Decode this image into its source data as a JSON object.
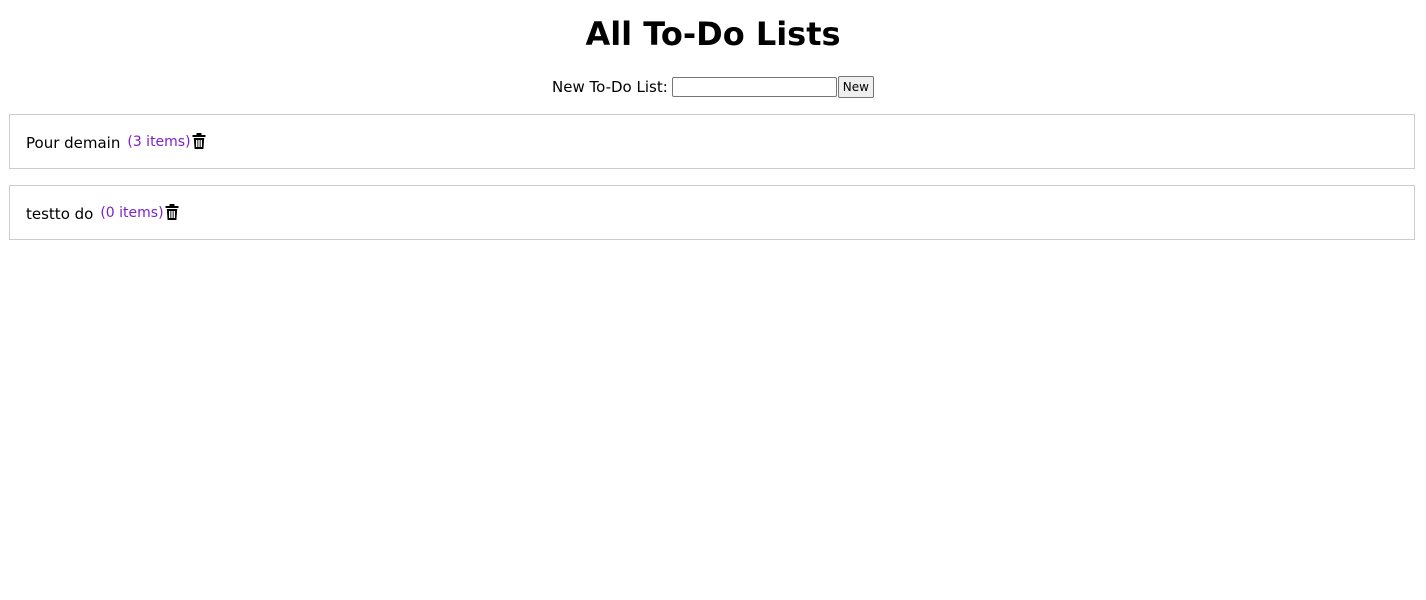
{
  "header": {
    "title": "All To-Do Lists"
  },
  "new_list": {
    "label": "New To-Do List:",
    "input_value": "",
    "button_label": "New"
  },
  "lists": [
    {
      "name": "Pour demain",
      "count": "(3 items)",
      "icon": "trash-icon"
    },
    {
      "name": "testto do",
      "count": "(0 items)",
      "icon": "trash-icon"
    }
  ],
  "colors": {
    "count_text": "#7b22c8",
    "border": "#cccccc"
  }
}
